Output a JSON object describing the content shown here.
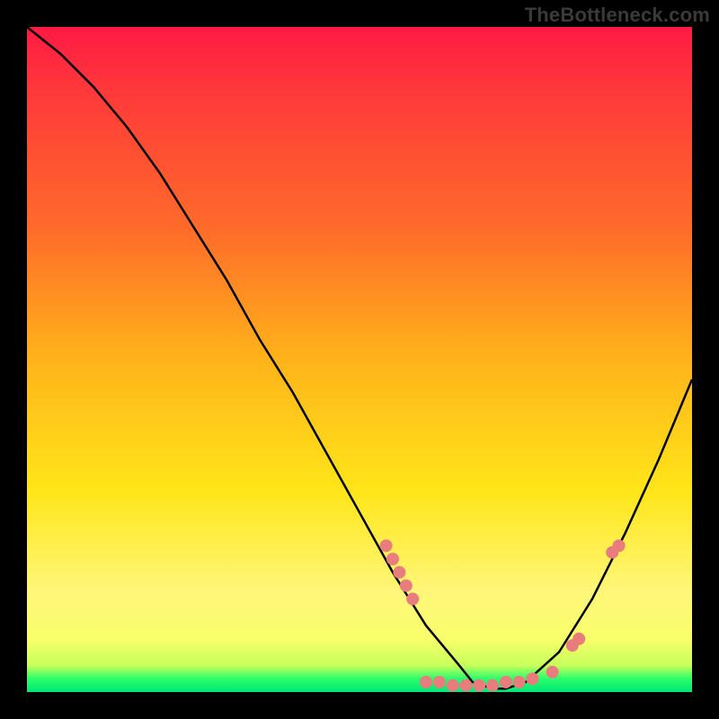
{
  "watermark": "TheBottleneck.com",
  "colors": {
    "background": "#000000",
    "curve_stroke": "#000000",
    "marker_fill": "#e97c7c",
    "gradient_stops": [
      "#ff1a44",
      "#ff3a3a",
      "#ff6a2a",
      "#ffb31a",
      "#ffe61a",
      "#fff67a",
      "#f8ff6a",
      "#c8ff5a",
      "#2bff6a",
      "#00e676"
    ]
  },
  "chart_data": {
    "type": "line",
    "title": "",
    "xlabel": "",
    "ylabel": "",
    "xlim": [
      0,
      100
    ],
    "ylim": [
      0,
      100
    ],
    "curve": {
      "x": [
        0,
        5,
        10,
        15,
        20,
        25,
        30,
        35,
        40,
        45,
        50,
        55,
        60,
        65,
        67,
        70,
        72,
        75,
        80,
        85,
        90,
        95,
        100
      ],
      "y": [
        100,
        96,
        91,
        85,
        78,
        70,
        62,
        53,
        45,
        36,
        27,
        18,
        10,
        4,
        1.5,
        0.5,
        0.5,
        1.5,
        6,
        14,
        24,
        35,
        47
      ]
    },
    "markers": [
      {
        "x": 54,
        "y": 22
      },
      {
        "x": 55,
        "y": 20
      },
      {
        "x": 56,
        "y": 18
      },
      {
        "x": 57,
        "y": 16
      },
      {
        "x": 58,
        "y": 14
      },
      {
        "x": 60,
        "y": 1.5
      },
      {
        "x": 62,
        "y": 1.5
      },
      {
        "x": 64,
        "y": 1
      },
      {
        "x": 66,
        "y": 1
      },
      {
        "x": 68,
        "y": 1
      },
      {
        "x": 70,
        "y": 1
      },
      {
        "x": 72,
        "y": 1.5
      },
      {
        "x": 74,
        "y": 1.5
      },
      {
        "x": 76,
        "y": 2
      },
      {
        "x": 79,
        "y": 3
      },
      {
        "x": 82,
        "y": 7
      },
      {
        "x": 83,
        "y": 8
      },
      {
        "x": 88,
        "y": 21
      },
      {
        "x": 89,
        "y": 22
      }
    ]
  }
}
